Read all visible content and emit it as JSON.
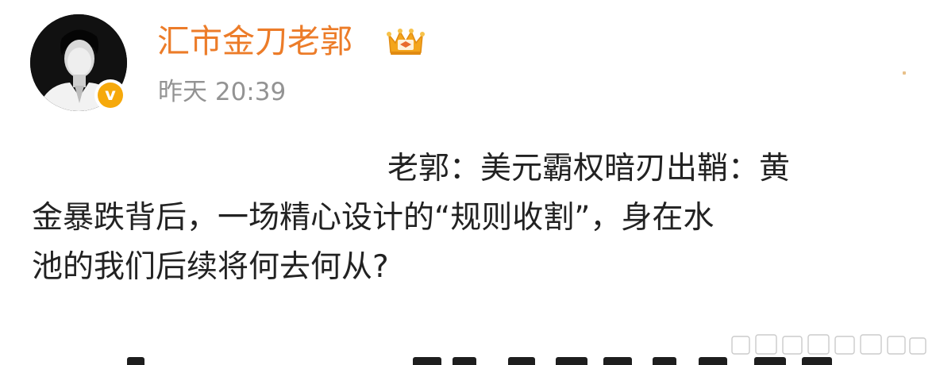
{
  "post": {
    "author": {
      "name": "汇市金刀老郭",
      "avatar_icon": "portrait-avatar",
      "verified_icon": "v",
      "badge_icon": "crown-badge-icon"
    },
    "timestamp": "昨天 20:39",
    "body_lines": [
      "老郭：美元霸权暗刃出鞘：黄",
      "金暴跌背后，一场精心设计的“规则收割”，身在水",
      "池的我们后续将何去何从?"
    ]
  },
  "colors": {
    "username": "#ec7c29",
    "timestamp": "#939393",
    "body_text": "#222222",
    "verified_badge": "#f6a90b",
    "crown_gold": "#f4a51c"
  }
}
